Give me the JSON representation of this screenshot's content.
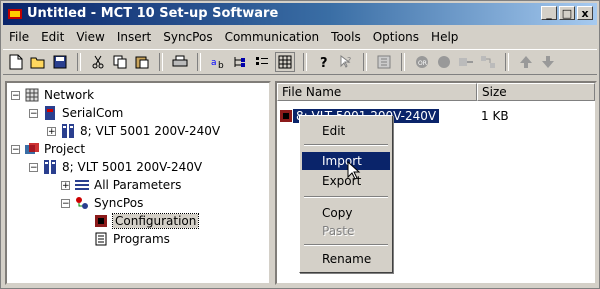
{
  "window": {
    "title": "Untitled - MCT 10 Set-up Software"
  },
  "controls": {
    "minimize": "_",
    "maximize": "□",
    "close": "x"
  },
  "menu": [
    "File",
    "Edit",
    "View",
    "Insert",
    "SyncPos",
    "Communication",
    "Tools",
    "Options",
    "Help"
  ],
  "toolbar": [
    "new-icon",
    "open-icon",
    "save-icon",
    "cut-icon",
    "copy-icon",
    "paste-icon",
    "print-icon",
    "ab-icon",
    "tree-icon",
    "list-icon",
    "grid-icon",
    "help-icon",
    "whatsthis-icon",
    "calc-icon",
    "record-icon",
    "stop-icon",
    "connect-icon",
    "network-icon",
    "up-icon",
    "down-icon"
  ],
  "tree": {
    "network": "Network",
    "serialcom": "SerialCom",
    "device1": "8; VLT 5001 200V-240V",
    "project": "Project",
    "device2": "8; VLT 5001 200V-240V",
    "all_params": "All Parameters",
    "syncpos": "SyncPos",
    "configuration": "Configuration",
    "programs": "Programs"
  },
  "list": {
    "col_name": "File Name",
    "col_size": "Size",
    "file_name": "8; VLT 5001 200V-240V",
    "file_size": "1 KB"
  },
  "context_menu": {
    "edit": "Edit",
    "import": "Import",
    "export": "Export",
    "copy": "Copy",
    "paste": "Paste",
    "rename": "Rename"
  }
}
